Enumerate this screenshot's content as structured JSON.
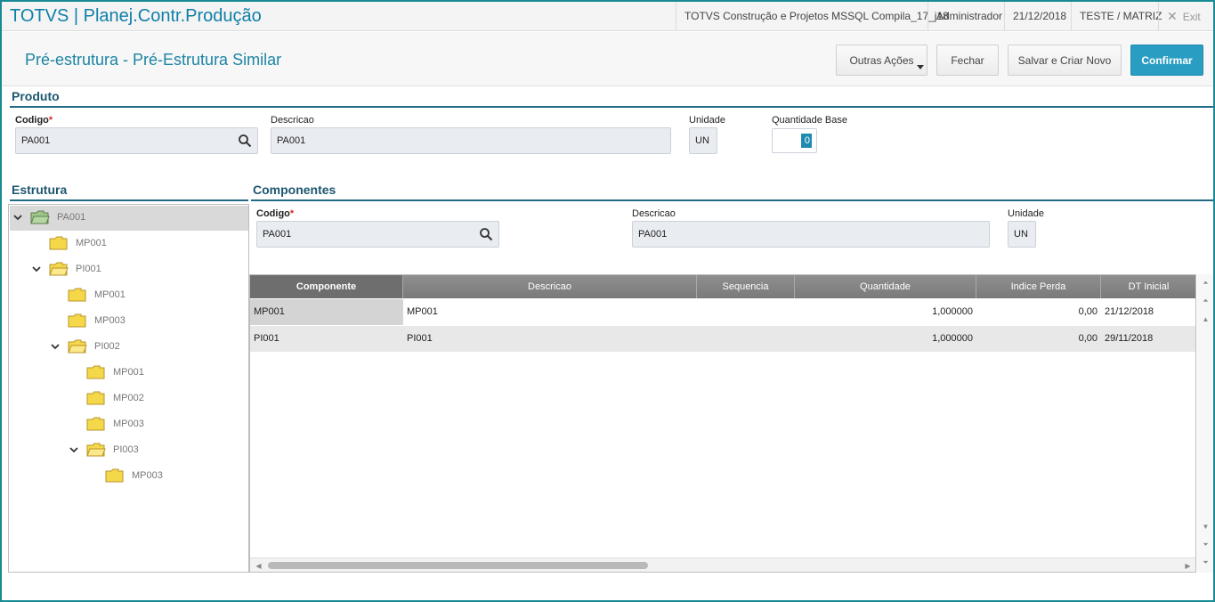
{
  "titlebar": {
    "app_title": "TOTVS | Planej.Contr.Produção",
    "environment": "TOTVS Construção e Projetos MSSQL Compila_17_j18",
    "user": "Administrador",
    "date": "21/12/2018",
    "company": "TESTE / MATRIZ",
    "exit_label": "Exit"
  },
  "header": {
    "title": "Pré-estrutura - Pré-Estrutura Similar",
    "buttons": {
      "other_actions": "Outras Ações",
      "close": "Fechar",
      "save_new": "Salvar e Criar Novo",
      "confirm": "Confirmar"
    }
  },
  "produto": {
    "section_title": "Produto",
    "codigo_label": "Codigo",
    "codigo_value": "PA001",
    "descricao_label": "Descricao",
    "descricao_value": "PA001",
    "unidade_label": "Unidade",
    "unidade_value": "UN",
    "qtd_label": "Quantidade Base",
    "qtd_value": "0"
  },
  "estrutura": {
    "section_title": "Estrutura",
    "nodes": [
      {
        "label": "PA001",
        "level": 0,
        "expanded": true,
        "selected": true
      },
      {
        "label": "MP001",
        "level": 1,
        "expanded": false
      },
      {
        "label": "PI001",
        "level": 1,
        "expanded": true
      },
      {
        "label": "MP001",
        "level": 2,
        "expanded": false
      },
      {
        "label": "MP003",
        "level": 2,
        "expanded": false
      },
      {
        "label": "PI002",
        "level": 2,
        "expanded": true
      },
      {
        "label": "MP001",
        "level": 3,
        "expanded": false
      },
      {
        "label": "MP002",
        "level": 3,
        "expanded": false
      },
      {
        "label": "MP003",
        "level": 3,
        "expanded": false
      },
      {
        "label": "PI003",
        "level": 3,
        "expanded": true
      },
      {
        "label": "MP003",
        "level": 4,
        "expanded": false
      }
    ]
  },
  "componentes": {
    "section_title": "Componentes",
    "codigo_label": "Codigo",
    "codigo_value": "PA001",
    "descricao_label": "Descricao",
    "descricao_value": "PA001",
    "unidade_label": "Unidade",
    "unidade_value": "UN"
  },
  "grid": {
    "columns": [
      "Componente",
      "Descricao",
      "Sequencia",
      "Quantidade",
      "Indice Perda",
      "DT Inicial"
    ],
    "rows": [
      [
        "MP001",
        "MP001",
        "",
        "1,000000",
        "0,00",
        "21/12/2018"
      ],
      [
        "PI001",
        "PI001",
        "",
        "1,000000",
        "0,00",
        "29/11/2018"
      ]
    ]
  },
  "colors": {
    "accent": "#1d84a3",
    "primary_button": "#2a9dc3",
    "section_line": "#236b85",
    "folder": "#f5d84a"
  }
}
